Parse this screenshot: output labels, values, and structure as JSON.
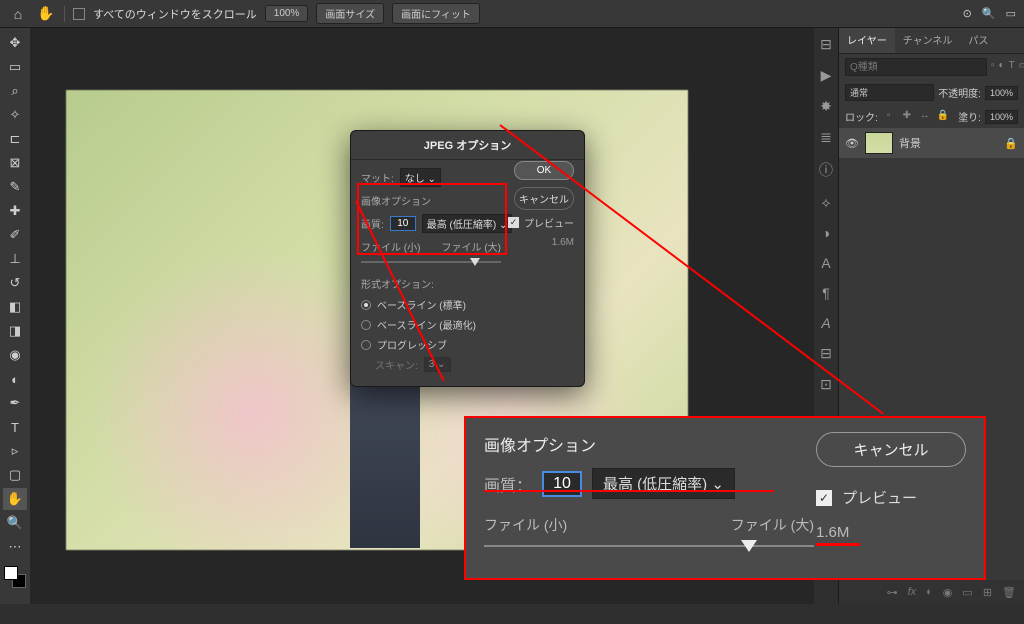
{
  "topbar": {
    "scroll_all": "すべてのウィンドウをスクロール",
    "zoom": "100%",
    "fit_screen": "画面サイズ",
    "fit_window": "画面にフィット"
  },
  "panels": {
    "tabs": {
      "layers": "レイヤー",
      "channels": "チャンネル",
      "paths": "パス"
    },
    "search_placeholder": "Q種類",
    "blend": "通常",
    "opacity_label": "不透明度:",
    "opacity": "100%",
    "lock_label": "ロック:",
    "fill_label": "塗り:",
    "fill": "100%",
    "layer_name": "背景"
  },
  "dialog": {
    "title": "JPEG オプション",
    "matte_label": "マット:",
    "matte_value": "なし",
    "section_image": "画像オプション",
    "quality_label": "画質:",
    "quality_value": "10",
    "quality_preset": "最高 (低圧縮率)",
    "slider_small": "ファイル (小)",
    "slider_large": "ファイル (大)",
    "section_format": "形式オプション:",
    "radio1": "ベースライン (標準)",
    "radio2": "ベースライン (最適化)",
    "radio3": "プログレッシブ",
    "scans_label": "スキャン:",
    "scans_value": "3",
    "ok": "OK",
    "cancel": "キャンセル",
    "preview": "プレビュー",
    "filesize": "1.6M"
  },
  "callout": {
    "header": "画像オプション",
    "quality_label": "画質：",
    "quality_value": "10",
    "quality_preset": "最高 (低圧縮率)",
    "slider_small": "ファイル (小)",
    "slider_large": "ファイル (大)",
    "cancel": "キャンセル",
    "preview": "プレビュー",
    "filesize": "1.6M"
  }
}
